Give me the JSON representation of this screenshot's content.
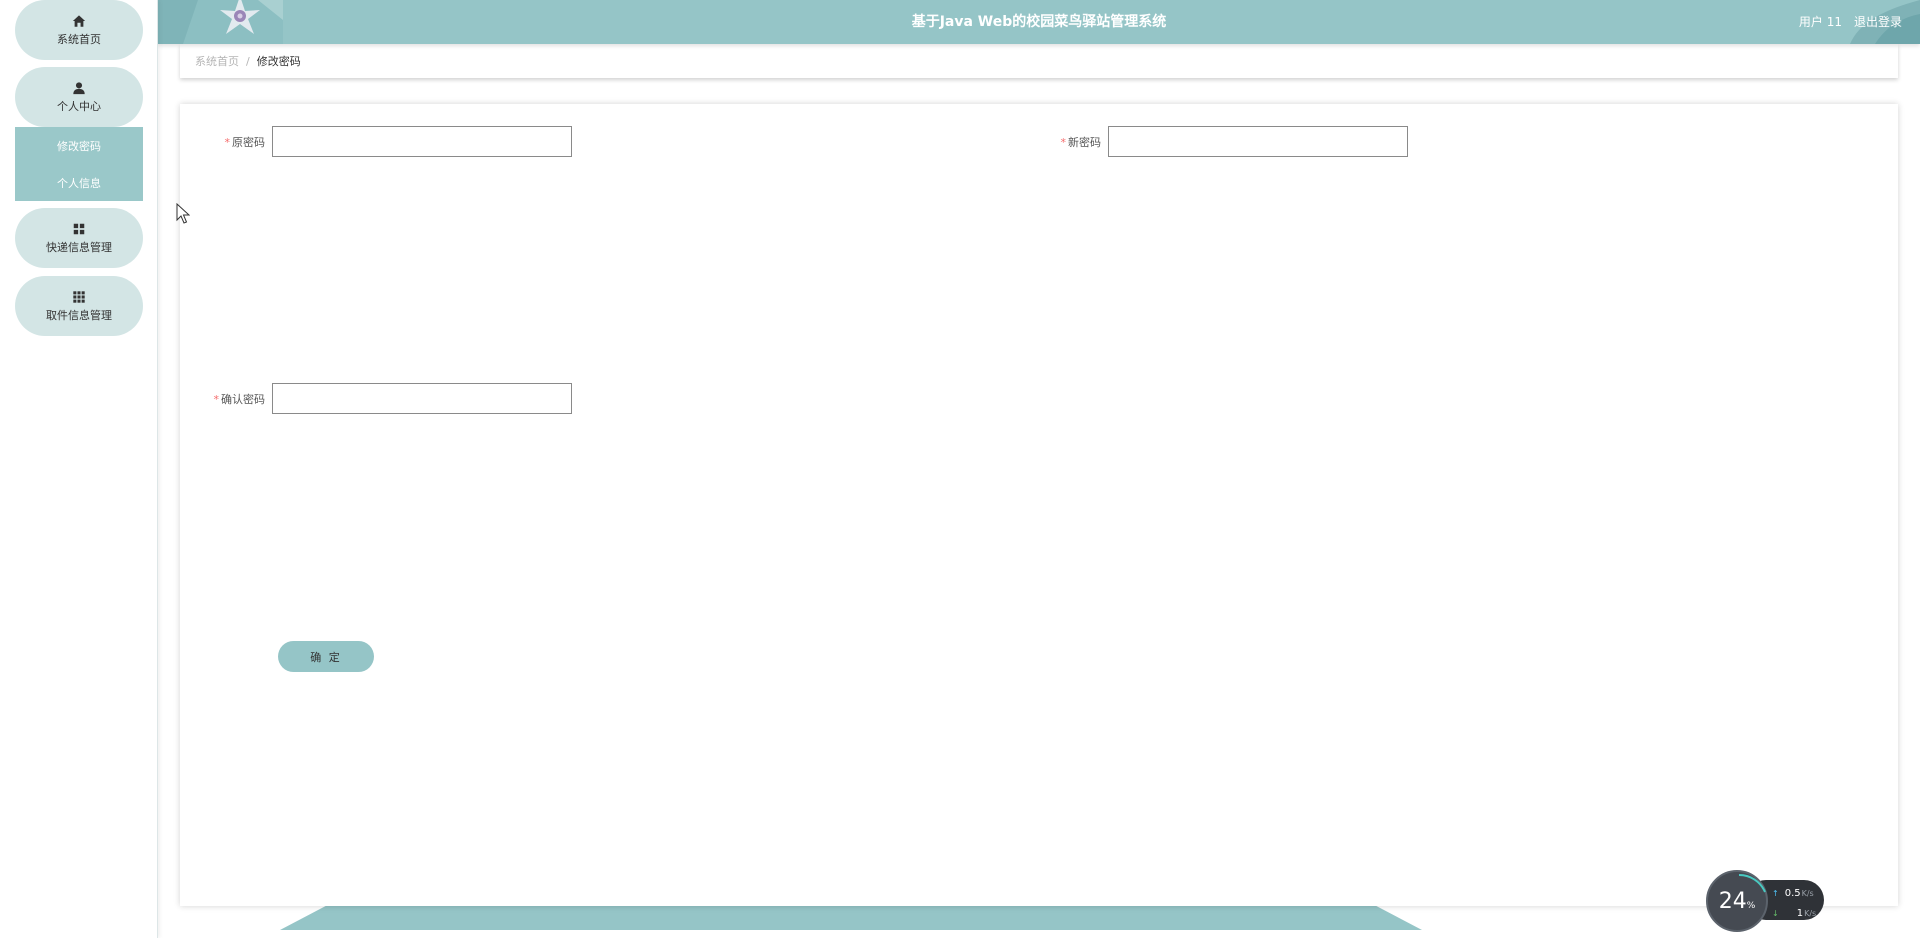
{
  "header": {
    "title": "基于Java Web的校园菜鸟驿站管理系统",
    "user_label": "用户 11",
    "logout_label": "退出登录"
  },
  "sidebar": {
    "items": [
      {
        "label": "系统首页",
        "icon": "home-icon"
      },
      {
        "label": "个人中心",
        "icon": "user-icon"
      },
      {
        "label": "快递信息管理",
        "icon": "grid-icon"
      },
      {
        "label": "取件信息管理",
        "icon": "apps-icon"
      }
    ],
    "submenu": [
      {
        "label": "修改密码"
      },
      {
        "label": "个人信息"
      }
    ]
  },
  "breadcrumb": {
    "home": "系统首页",
    "separator": "/",
    "current": "修改密码"
  },
  "form": {
    "required_mark": "*",
    "old_password": {
      "label": "原密码",
      "value": "",
      "placeholder": ""
    },
    "new_password": {
      "label": "新密码",
      "value": "",
      "placeholder": ""
    },
    "confirm_password": {
      "label": "确认密码",
      "value": "",
      "placeholder": ""
    },
    "submit_label": "确 定"
  },
  "network_widget": {
    "cpu_percent": "24",
    "percent_sign": "%",
    "upload_speed": "0.5",
    "download_speed": "1",
    "unit": "K/s",
    "up_arrow": "↑",
    "down_arrow": "↓"
  },
  "colors": {
    "accent": "#95c5c7",
    "nav_pill": "#d3e5e5",
    "submenu": "#9ac8c9",
    "required": "#f56c6c"
  }
}
